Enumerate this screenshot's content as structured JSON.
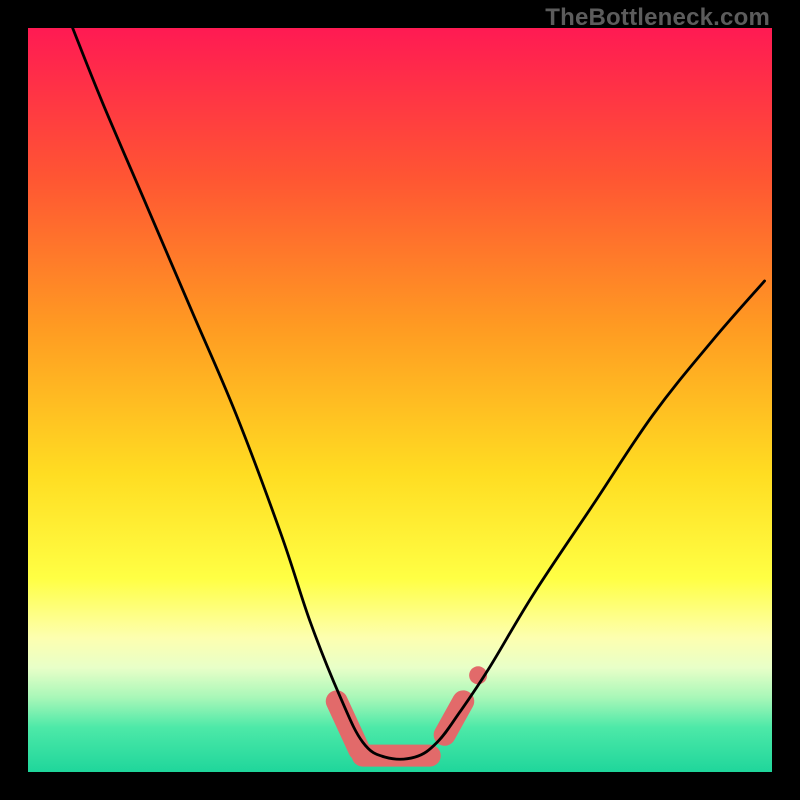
{
  "watermark": "TheBottleneck.com",
  "chart_data": {
    "type": "line",
    "title": "",
    "xlabel": "",
    "ylabel": "",
    "xlim": [
      0,
      100
    ],
    "ylim": [
      0,
      100
    ],
    "gradient_stops": [
      {
        "offset": 0.0,
        "color": "#ff1a53"
      },
      {
        "offset": 0.2,
        "color": "#ff5533"
      },
      {
        "offset": 0.4,
        "color": "#ff9a22"
      },
      {
        "offset": 0.6,
        "color": "#ffdd22"
      },
      {
        "offset": 0.74,
        "color": "#ffff44"
      },
      {
        "offset": 0.82,
        "color": "#fdffb0"
      },
      {
        "offset": 0.86,
        "color": "#e8ffc8"
      },
      {
        "offset": 0.9,
        "color": "#a8f7b8"
      },
      {
        "offset": 0.94,
        "color": "#4de9a8"
      },
      {
        "offset": 1.0,
        "color": "#1fd69b"
      }
    ],
    "series": [
      {
        "name": "bottleneck-curve",
        "x": [
          6,
          10,
          16,
          22,
          28,
          34,
          38,
          42,
          45,
          48,
          52,
          55,
          58,
          62,
          68,
          76,
          84,
          92,
          99
        ],
        "y": [
          100,
          90,
          76,
          62,
          48,
          32,
          20,
          10,
          4,
          2,
          2,
          4,
          8,
          14,
          24,
          36,
          48,
          58,
          66
        ]
      }
    ],
    "markers": [
      {
        "name": "min-marker-segment-1",
        "x": [
          41.5,
          44.5
        ],
        "y": [
          9.5,
          3.0
        ],
        "color": "#e26a6a",
        "width": 22
      },
      {
        "name": "min-marker-segment-2",
        "x": [
          45,
          54
        ],
        "y": [
          2.2,
          2.2
        ],
        "color": "#e26a6a",
        "width": 22
      },
      {
        "name": "min-marker-segment-3",
        "x": [
          56,
          58.5
        ],
        "y": [
          5.0,
          9.5
        ],
        "color": "#e26a6a",
        "width": 22
      },
      {
        "name": "min-marker-dot",
        "x": [
          60.5
        ],
        "y": [
          13.0
        ],
        "color": "#e26a6a",
        "width": 18
      }
    ]
  }
}
